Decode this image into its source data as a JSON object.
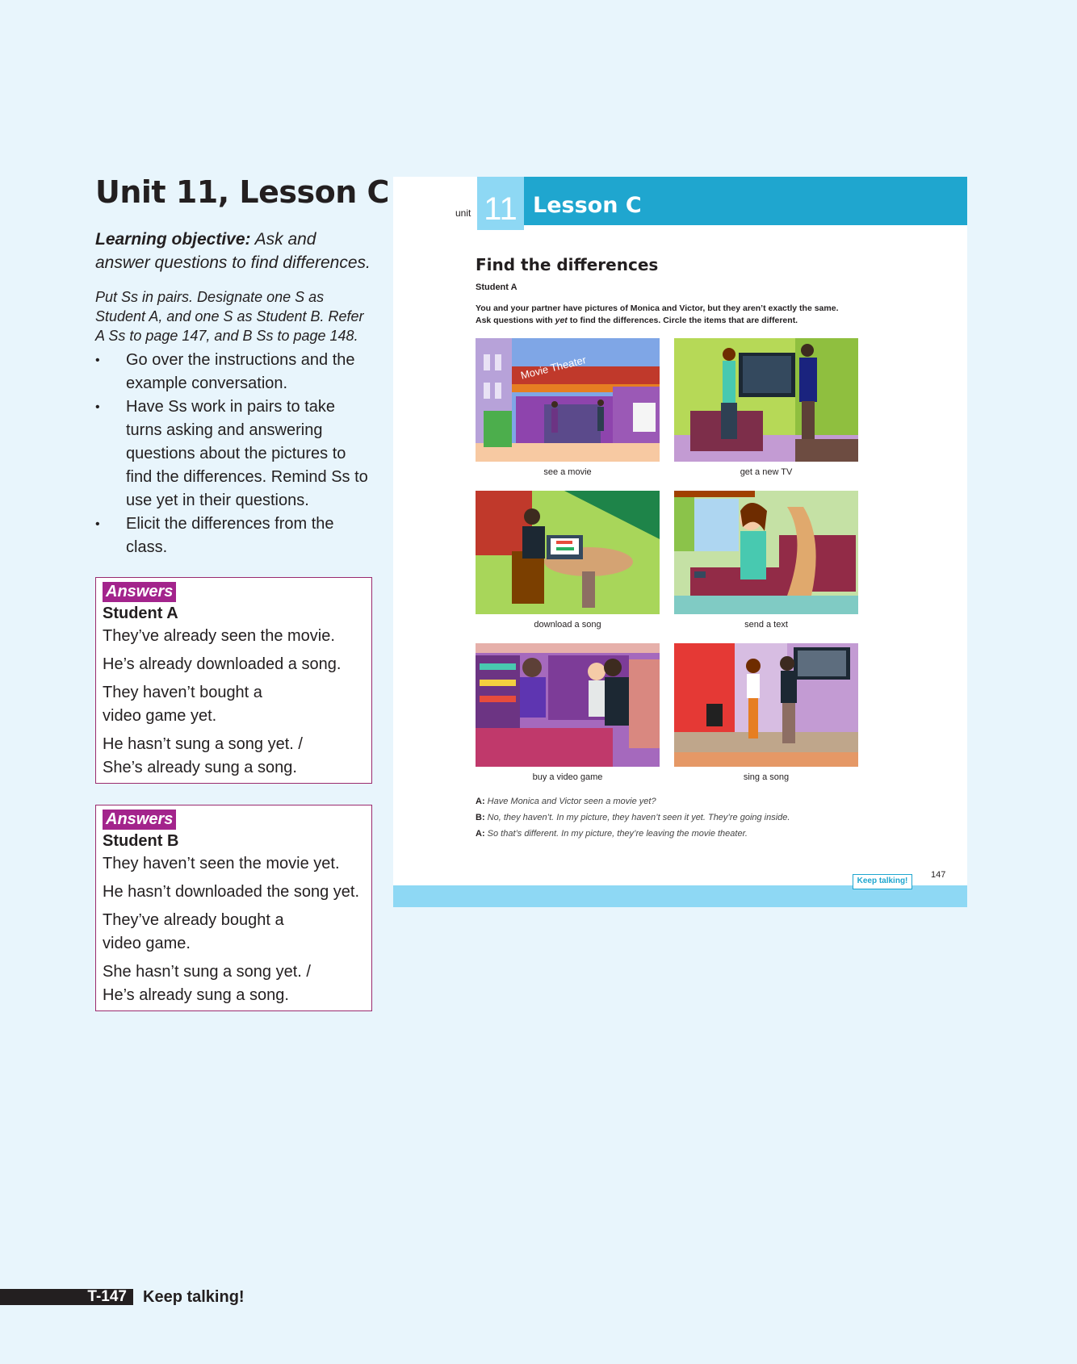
{
  "teacher": {
    "unit_title": "Unit 11, Lesson C",
    "objective_label": "Learning objective:",
    "objective_text": " Ask and answer questions to find differences.",
    "intro": "Put Ss in pairs. Designate one S as Student A, and one S as Student B. Refer A Ss to page 147, and B Ss to page 148.",
    "bullets": [
      "Go over the instructions and the example conversation.",
      "Have Ss work in pairs to take turns asking and answering questions about the pictures to find the differences. Remind Ss to use yet in their questions.",
      "Elicit the differences from the class."
    ],
    "answers_a": {
      "badge": "Answers",
      "student": "Student A",
      "lines": [
        "They’ve already seen the movie.",
        "He’s already downloaded a song.",
        "They haven’t bought a video game yet.",
        "He hasn’t sung a song yet. / She’s already sung a song."
      ]
    },
    "answers_b": {
      "badge": "Answers",
      "student": "Student B",
      "lines": [
        "They haven’t seen the movie yet.",
        "He hasn’t downloaded the song yet.",
        "They’ve already bought a video game.",
        "She hasn’t sung a song yet. / He’s already sung a song."
      ]
    }
  },
  "footer": {
    "code": "T-147",
    "title": "Keep talking!"
  },
  "book": {
    "unit_word": "unit",
    "unit_number": "11",
    "lesson_label": "Lesson C",
    "section_title": "Find the differences",
    "student_label": "Student A",
    "instruction_line1": "You and your partner have pictures of Monica and Victor, but they aren’t exactly the same.",
    "instruction_line2_pre": "Ask questions with ",
    "instruction_line2_em": "yet",
    "instruction_line2_post": " to find the differences. Circle the items that are different.",
    "pictures": [
      {
        "caption": "see a movie",
        "sign": "Movie Theater"
      },
      {
        "caption": "get a new TV"
      },
      {
        "caption": "download a song"
      },
      {
        "caption": "send a text"
      },
      {
        "caption": "buy a video game"
      },
      {
        "caption": "sing a song"
      }
    ],
    "dialog": [
      {
        "speaker": "A:",
        "text": " Have Monica and Victor seen a movie yet?"
      },
      {
        "speaker": "B:",
        "text": " No, they haven’t. In my picture, they haven’t seen it yet. They’re going inside."
      },
      {
        "speaker": "A:",
        "text": " So that’s different. In my picture, they’re leaving the movie theater."
      }
    ],
    "keep_talking_button": "Keep talking!",
    "page_number": "147"
  },
  "colors": {
    "page_bg": "#e8f5fc",
    "header_blue": "#1fa6cf",
    "light_blue": "#8ed8f4",
    "answers_magenta": "#a3248c",
    "answers_border": "#9a2a6e"
  }
}
